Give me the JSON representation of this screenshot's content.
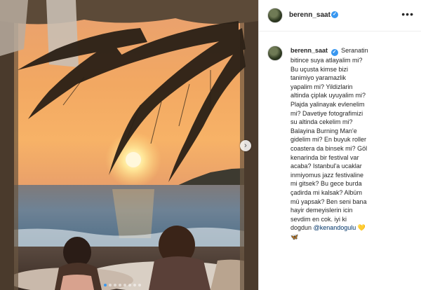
{
  "post": {
    "username": "berenn_saat",
    "verified_icon": "verified-badge-icon",
    "more_icon": "ellipsis-icon",
    "caption": {
      "username": "berenn_saat",
      "lines": [
        "Seranatin bitince suya",
        "atlayalim mi? Bu uçusta kimse bizi",
        "tanimiyo yaramazlik yapalim mi?",
        "Yildizlarin altinda çiplak uyuyalim mi?",
        "Plajda yalinayak evlenelim mi?",
        "Davetiye fotografimizi su altinda",
        "cekelim mi? Balayina Burning Man'e",
        "gidelim mi? En buyuk roller coastera",
        "da binsek mi? Göl kenarinda bir",
        "festival var acaba? Istanbul'a ucaklar",
        "inmiyomus jazz festivaline mi gitsek?",
        "Bu gece burda çadirda mi kalsak?",
        "Albüm mü yapsak? Ben seni bana",
        "hayir demeyislerin icin sevdim en cok.",
        "iyi ki dogdun"
      ],
      "mention": "@kenandogulu",
      "emojis": "💛🦋"
    },
    "carousel": {
      "next_icon": "chevron-right-icon",
      "dot_count": 8,
      "active_index": 0
    }
  },
  "colors": {
    "accent": "#3897f0",
    "text": "#262626",
    "mention": "#003569"
  }
}
